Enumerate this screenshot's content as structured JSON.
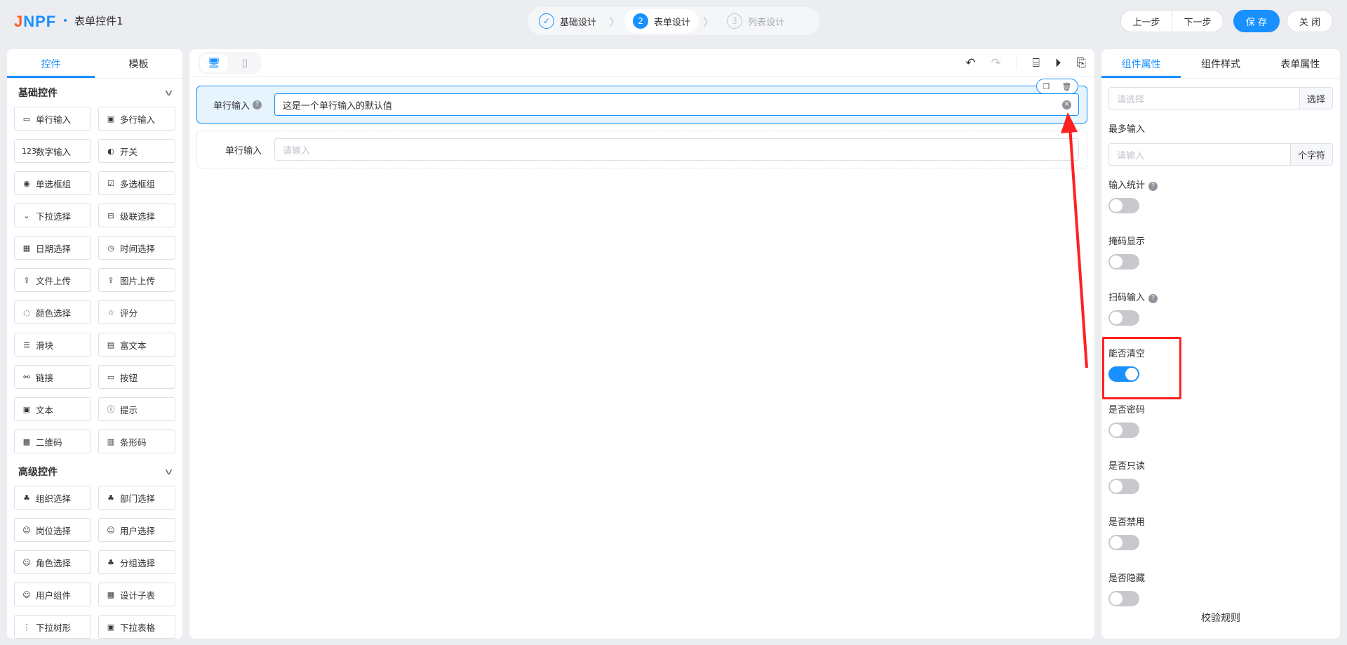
{
  "header": {
    "logo": "JNPF",
    "title": "表单控件1",
    "steps": [
      {
        "num": "✓",
        "label": "基础设计",
        "state": "done"
      },
      {
        "num": "2",
        "label": "表单设计",
        "state": "active"
      },
      {
        "num": "3",
        "label": "列表设计",
        "state": "todo"
      }
    ],
    "prev": "上一步",
    "next": "下一步",
    "save": "保 存",
    "close": "关 闭"
  },
  "left": {
    "tabs": [
      "控件",
      "模板"
    ],
    "groups": [
      {
        "title": "基础控件",
        "items": [
          {
            "icon": "▭",
            "label": "单行输入"
          },
          {
            "icon": "▣",
            "label": "多行输入"
          },
          {
            "icon": "123",
            "label": "数字输入"
          },
          {
            "icon": "◐",
            "label": "开关"
          },
          {
            "icon": "◉",
            "label": "单选框组"
          },
          {
            "icon": "☑",
            "label": "多选框组"
          },
          {
            "icon": "⌄",
            "label": "下拉选择"
          },
          {
            "icon": "⊟",
            "label": "级联选择"
          },
          {
            "icon": "▦",
            "label": "日期选择"
          },
          {
            "icon": "◷",
            "label": "时间选择"
          },
          {
            "icon": "⇪",
            "label": "文件上传"
          },
          {
            "icon": "⇪",
            "label": "图片上传"
          },
          {
            "icon": "◌",
            "label": "颜色选择"
          },
          {
            "icon": "☆",
            "label": "评分"
          },
          {
            "icon": "☰",
            "label": "滑块"
          },
          {
            "icon": "▤",
            "label": "富文本"
          },
          {
            "icon": "⚯",
            "label": "链接"
          },
          {
            "icon": "▭",
            "label": "按钮"
          },
          {
            "icon": "▣",
            "label": "文本"
          },
          {
            "icon": "ⓘ",
            "label": "提示"
          },
          {
            "icon": "▩",
            "label": "二维码"
          },
          {
            "icon": "▥",
            "label": "条形码"
          }
        ]
      },
      {
        "title": "高级控件",
        "items": [
          {
            "icon": "♣",
            "label": "组织选择"
          },
          {
            "icon": "♣",
            "label": "部门选择"
          },
          {
            "icon": "☺",
            "label": "岗位选择"
          },
          {
            "icon": "☺",
            "label": "用户选择"
          },
          {
            "icon": "☺",
            "label": "角色选择"
          },
          {
            "icon": "♣",
            "label": "分组选择"
          },
          {
            "icon": "☺",
            "label": "用户组件"
          },
          {
            "icon": "▦",
            "label": "设计子表"
          },
          {
            "icon": "⋮",
            "label": "下拉树形"
          },
          {
            "icon": "▣",
            "label": "下拉表格"
          }
        ]
      }
    ]
  },
  "canvas": {
    "fields": [
      {
        "label": "单行输入",
        "value": "这是一个单行输入的默认值",
        "help": true,
        "selected": true
      },
      {
        "label": "单行输入",
        "placeholder": "请输入",
        "help": false,
        "selected": false
      }
    ]
  },
  "right": {
    "tabs": [
      "组件属性",
      "组件样式",
      "表单属性"
    ],
    "select_placeholder": "请选择",
    "select_button": "选择",
    "max_label": "最多输入",
    "max_placeholder": "请输入",
    "max_suffix": "个字符",
    "switches": [
      {
        "label": "输入统计",
        "help": true,
        "on": false
      },
      {
        "label": "掩码显示",
        "help": false,
        "on": false
      },
      {
        "label": "扫码输入",
        "help": true,
        "on": false
      },
      {
        "label": "能否清空",
        "help": false,
        "on": true
      },
      {
        "label": "是否密码",
        "help": false,
        "on": false
      },
      {
        "label": "是否只读",
        "help": false,
        "on": false
      },
      {
        "label": "是否禁用",
        "help": false,
        "on": false
      },
      {
        "label": "是否隐藏",
        "help": false,
        "on": false
      }
    ],
    "rules_title": "校验规则"
  },
  "colors": {
    "accent": "#1890ff",
    "annotation": "#ff2020"
  }
}
